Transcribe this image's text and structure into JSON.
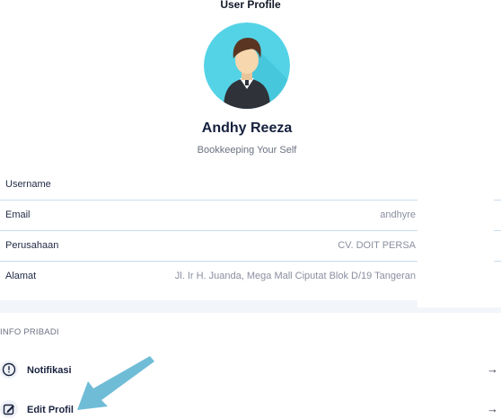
{
  "header": {
    "title": "User Profile"
  },
  "profile": {
    "name": "Andhy Reeza",
    "subtitle": "Bookkeeping Your Self"
  },
  "info": [
    {
      "label": "Username",
      "value": ""
    },
    {
      "label": "Email",
      "value": "andhyre"
    },
    {
      "label": "Perusahaan",
      "value": "CV. DOIT PERSA"
    },
    {
      "label": "Alamat",
      "value": "Jl. Ir H. Juanda, Mega Mall Ciputat Blok D/19 Tangeran"
    }
  ],
  "section": {
    "title": "INFO PRIBADI"
  },
  "menu": [
    {
      "label": "Notifikasi",
      "icon": "alert-circle-icon",
      "arrow": "→"
    },
    {
      "label": "Edit Profil",
      "icon": "edit-icon",
      "arrow": "→"
    }
  ],
  "colors": {
    "avatar_bg": "#55d3e6",
    "divider": "#c9dcef",
    "annotation_arrow": "#6fbcd6"
  }
}
